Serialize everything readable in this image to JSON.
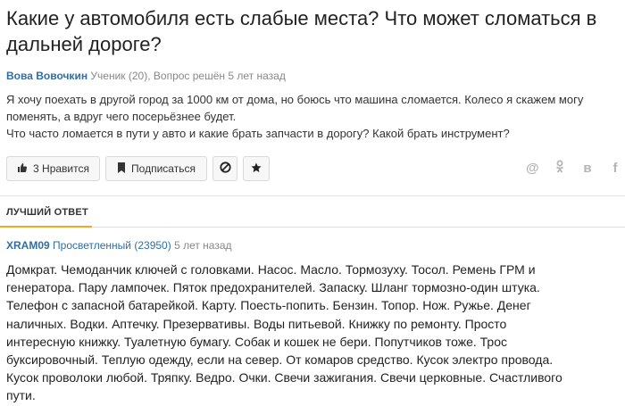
{
  "question": {
    "title": "Какие у автомобиля есть слабые места? Что может сломаться в дальней дороге?",
    "author": "Вова Вовочкин",
    "author_info": "Ученик (20), Вопрос решён 5 лет назад",
    "body_lines": [
      "Я хочу поехать в другой город за 1000 км от дома, но боюсь что машина сломается. Колесо я скажем могу поменять, а вдруг чего посерьёзнее будет.",
      "Что часто ломается в пути у авто и какие брать запчасти в дорогу? Какой брать инструмент?"
    ]
  },
  "actions": {
    "like_label": "3 Нравится",
    "subscribe_label": "Подписаться"
  },
  "share": {
    "email": "@",
    "ok": "ок",
    "vk": "в",
    "fb": "f"
  },
  "best_answer": {
    "tab_label": "ЛУЧШИЙ ОТВЕТ",
    "author": "XRAM09",
    "rank": "Просветленный (23950)",
    "time": "5 лет назад",
    "text": "Домкрат. Чемоданчик ключей с головками. Насос. Масло. Тормозуху. Тосол. Ремень ГРМ и генератора. Пару лампочек. Пяток предохранителей. Запаску. Шланг тормозно-один штука. Телефон с запасной батарейкой. Карту. Поесть-попить. Бензин. Топор. Нож. Ружье. Денег наличных. Водки. Аптечку. Презервативы. Воды питьевой. Книжку по ремонту. Просто интересную книжку. Туалетную бумагу. Собак и кошек не бери. Попутчиков тоже. Трос буксировочный. Теплую одежду, если на север. От комаров средство. Кусок электро провода. Кусок проволоки любой. Тряпку. Ведро. Очки. Свечи зажигания. Свечи церковные. Счастливого пути."
  },
  "colors": {
    "link": "#2f6ea6",
    "accent": "#f5a623"
  }
}
